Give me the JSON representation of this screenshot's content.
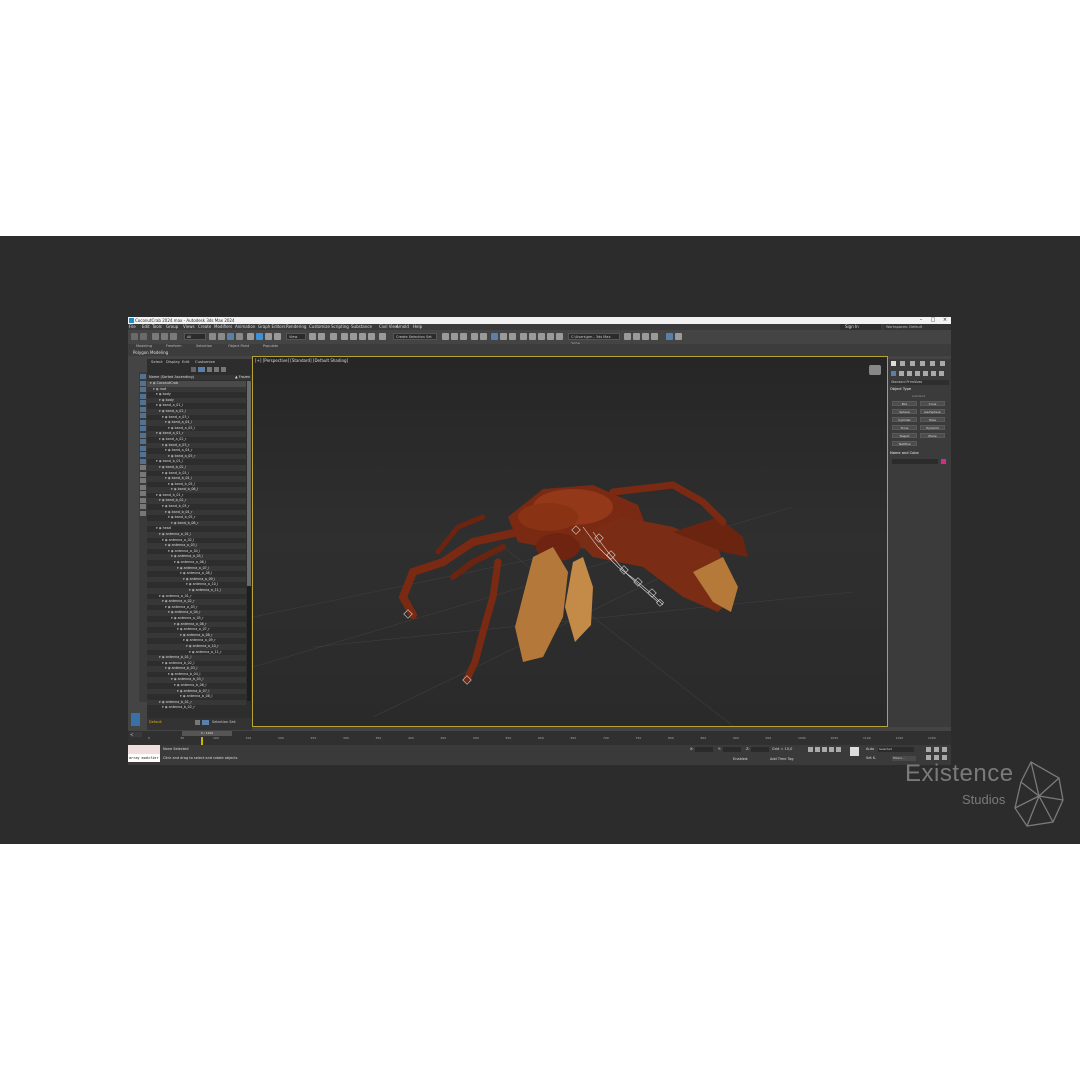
{
  "app": {
    "title": "CoconutCrab 2024.max - Autodesk 3ds Max 2024",
    "menus": [
      "File",
      "Edit",
      "Tools",
      "Group",
      "Views",
      "Create",
      "Modifiers",
      "Animation",
      "Graph Editors",
      "Rendering",
      "Customize",
      "Scripting",
      "Substance",
      "Civil View",
      "Arnold",
      "Help"
    ],
    "sign_in": "Sign In",
    "workspaces_label": "Workspaces:",
    "workspaces_value": "Default"
  },
  "toolbar": {
    "selection_filter": "All",
    "view_dropdown": "View",
    "named_selection": "Create Selection Set",
    "project": "C:\\Users\\pm - 3ds Max 2024"
  },
  "ribbon": {
    "tabs": [
      "Modeling",
      "Freeform",
      "Selection",
      "Object Paint",
      "Populate"
    ],
    "sub_label": "Polygon Modeling"
  },
  "scene_explorer": {
    "tabs": [
      "Select",
      "Display",
      "Edit",
      "Customize"
    ],
    "column_header": "Name (Sorted Ascending)",
    "frozen_header": "▲ Frozen",
    "layer_dropdown": "Default",
    "selection_set": "Selection Set:",
    "rows": [
      {
        "name": "CoconutCrab",
        "depth": 0
      },
      {
        "name": "root",
        "depth": 1
      },
      {
        "name": "body",
        "depth": 2
      },
      {
        "name": "body",
        "depth": 3
      },
      {
        "name": "band_a_01_l",
        "depth": 2
      },
      {
        "name": "band_a_02_l",
        "depth": 3
      },
      {
        "name": "band_a_03_l",
        "depth": 4
      },
      {
        "name": "band_a_04_l",
        "depth": 5
      },
      {
        "name": "band_a_05_l",
        "depth": 6
      },
      {
        "name": "band_a_01_r",
        "depth": 2
      },
      {
        "name": "band_a_02_r",
        "depth": 3
      },
      {
        "name": "band_a_03_r",
        "depth": 4
      },
      {
        "name": "band_a_04_r",
        "depth": 5
      },
      {
        "name": "band_a_05_r",
        "depth": 6
      },
      {
        "name": "band_b_01_l",
        "depth": 2
      },
      {
        "name": "band_b_02_l",
        "depth": 3
      },
      {
        "name": "band_b_03_l",
        "depth": 4
      },
      {
        "name": "band_b_04_l",
        "depth": 5
      },
      {
        "name": "band_b_05_l",
        "depth": 6
      },
      {
        "name": "band_b_06_l",
        "depth": 7
      },
      {
        "name": "band_b_01_r",
        "depth": 2
      },
      {
        "name": "band_b_02_r",
        "depth": 3
      },
      {
        "name": "band_b_03_r",
        "depth": 4
      },
      {
        "name": "band_b_04_r",
        "depth": 5
      },
      {
        "name": "band_b_05_r",
        "depth": 6
      },
      {
        "name": "band_b_06_r",
        "depth": 7
      },
      {
        "name": "head",
        "depth": 2
      },
      {
        "name": "antenna_a_01_l",
        "depth": 3
      },
      {
        "name": "antenna_a_02_l",
        "depth": 4
      },
      {
        "name": "antenna_a_03_l",
        "depth": 5
      },
      {
        "name": "antenna_a_04_l",
        "depth": 6
      },
      {
        "name": "antenna_a_05_l",
        "depth": 7
      },
      {
        "name": "antenna_a_06_l",
        "depth": 8
      },
      {
        "name": "antenna_a_07_l",
        "depth": 9
      },
      {
        "name": "antenna_a_08_l",
        "depth": 10
      },
      {
        "name": "antenna_a_09_l",
        "depth": 11
      },
      {
        "name": "antenna_a_10_l",
        "depth": 12
      },
      {
        "name": "antenna_a_11_l",
        "depth": 13
      },
      {
        "name": "antenna_a_01_r",
        "depth": 3
      },
      {
        "name": "antenna_a_02_r",
        "depth": 4
      },
      {
        "name": "antenna_a_03_r",
        "depth": 5
      },
      {
        "name": "antenna_a_04_r",
        "depth": 6
      },
      {
        "name": "antenna_a_05_r",
        "depth": 7
      },
      {
        "name": "antenna_a_06_r",
        "depth": 8
      },
      {
        "name": "antenna_a_07_r",
        "depth": 9
      },
      {
        "name": "antenna_a_08_r",
        "depth": 10
      },
      {
        "name": "antenna_a_09_r",
        "depth": 11
      },
      {
        "name": "antenna_a_10_r",
        "depth": 12
      },
      {
        "name": "antenna_a_11_r",
        "depth": 13
      },
      {
        "name": "antenna_b_01_l",
        "depth": 3
      },
      {
        "name": "antenna_b_02_l",
        "depth": 4
      },
      {
        "name": "antenna_b_03_l",
        "depth": 5
      },
      {
        "name": "antenna_b_04_l",
        "depth": 6
      },
      {
        "name": "antenna_b_05_l",
        "depth": 7
      },
      {
        "name": "antenna_b_06_l",
        "depth": 8
      },
      {
        "name": "antenna_b_07_l",
        "depth": 9
      },
      {
        "name": "antenna_b_08_l",
        "depth": 10
      },
      {
        "name": "antenna_b_01_r",
        "depth": 3
      },
      {
        "name": "antenna_b_02_r",
        "depth": 4
      }
    ]
  },
  "viewport": {
    "label": "[+] [Perspective] [Standard] [Default Shading]"
  },
  "command_panel": {
    "category": "Standard Primitives",
    "object_type_header": "Object Type",
    "autogrid": "AutoGrid",
    "buttons": [
      "Box",
      "Cone",
      "Sphere",
      "GeoSphere",
      "Cylinder",
      "Tube",
      "Torus",
      "Pyramid",
      "Teapot",
      "Plane",
      "TextPlus"
    ],
    "name_color_header": "Name and Color",
    "color_swatch": "#d42b8a"
  },
  "timeline": {
    "frame_display": "0 / 1200",
    "ticks": [
      "0",
      "50",
      "100",
      "150",
      "200",
      "250",
      "300",
      "350",
      "400",
      "450",
      "500",
      "550",
      "600",
      "650",
      "700",
      "750",
      "800",
      "850",
      "900",
      "950",
      "1000",
      "1050",
      "1100",
      "1150",
      "1200"
    ]
  },
  "status": {
    "maxscript": "array modifier",
    "selection": "None Selected",
    "prompt": "Click and drag to select and rotate objects",
    "x_label": "X:",
    "y_label": "Y:",
    "z_label": "Z:",
    "grid": "Grid = 10,0",
    "enabled": "Enabled:",
    "add_time_tag": "Add Time Tag",
    "auto_key": "Auto",
    "set_key": "Set K.",
    "selected": "Selected",
    "filters": "Filters..."
  },
  "watermark": {
    "line1": "Existence",
    "line2": "Studios"
  }
}
